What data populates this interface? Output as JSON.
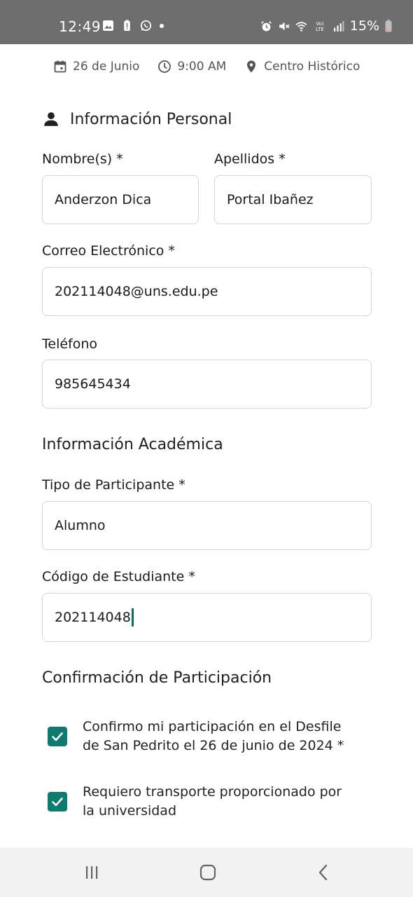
{
  "status_bar": {
    "time": "12:49",
    "battery": "15%",
    "left_icons": [
      "image-icon",
      "battery-alert-icon",
      "whatsapp-icon",
      "dot-icon"
    ],
    "right_icons": [
      "alarm-icon",
      "mute-icon",
      "wifi-icon",
      "volte-icon",
      "signal-icon",
      "battery-icon"
    ]
  },
  "event": {
    "date": "26 de Junio",
    "time": "9:00 AM",
    "location": "Centro Histórico"
  },
  "personal": {
    "title": "Información Personal",
    "first_name_label": "Nombre(s) *",
    "first_name_value": "Anderzon Dica",
    "last_name_label": "Apellidos *",
    "last_name_value": "Portal Ibañez",
    "email_label": "Correo Electrónico *",
    "email_value": "202114048@uns.edu.pe",
    "phone_label": "Teléfono",
    "phone_value": "985645434"
  },
  "academic": {
    "title": "Información Académica",
    "participant_type_label": "Tipo de Participante *",
    "participant_type_value": "Alumno",
    "student_code_label": "Código de Estudiante *",
    "student_code_value": "202114048"
  },
  "confirmation": {
    "title": "Confirmación de Participación",
    "items": [
      {
        "line1": "Confirmo mi participación en el Desfile",
        "line2": "de San Pedrito el 26 de junio de 2024 *",
        "checked": true
      },
      {
        "line1": "Requiero transporte proporcionado por",
        "line2": "la universidad",
        "checked": true
      }
    ]
  },
  "colors": {
    "status_bar": "#6e6e6e",
    "accent": "#0f7b6e",
    "input_border": "#d4d4d4",
    "nav_bar": "#f2f2f2"
  },
  "nav": [
    "recent-apps-icon",
    "home-icon",
    "back-icon"
  ]
}
